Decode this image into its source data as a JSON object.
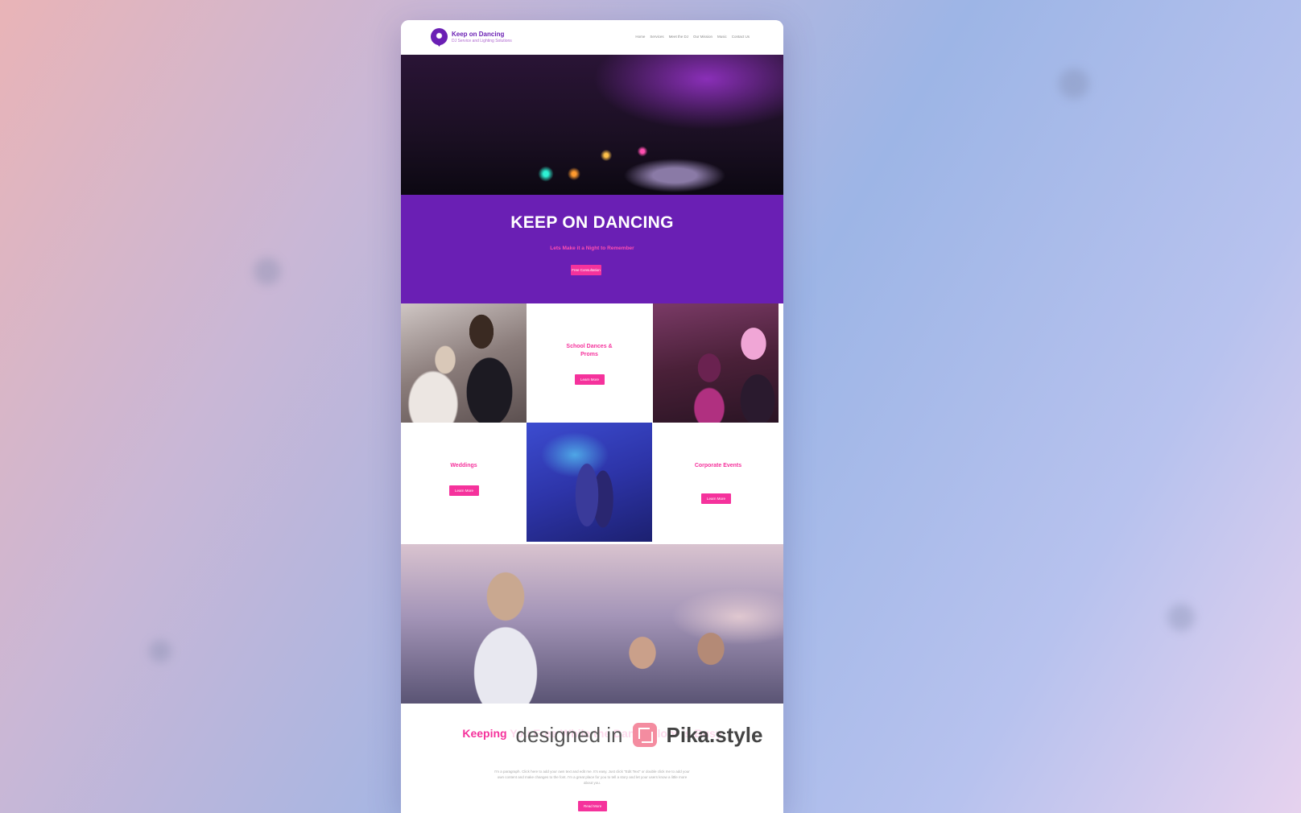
{
  "site": {
    "brand_name": "Keep on Dancing",
    "brand_tagline": "DJ Service and Lighting Solutions",
    "nav": [
      "Home",
      "Services",
      "Meet the DJ",
      "Our Mission",
      "Music",
      "Contact Us"
    ]
  },
  "hero": {
    "title": "KEEP ON DANCING",
    "subtitle": "Lets Make it a Night to Remember",
    "cta": "Free Consultation"
  },
  "services": {
    "school_dances": {
      "title": "School Dances & Proms",
      "button": "Learn More"
    },
    "weddings": {
      "title": "Weddings",
      "button": "Learn More"
    },
    "corporate": {
      "title": "Corporate Events",
      "button": "Learn More"
    }
  },
  "intro": {
    "title": "Keeping You Free While the Dance Floor is Busy",
    "body": "I'm a paragraph. Click here to add your own text and edit me. It's easy. Just click \"Edit Text\" or double click me to add your own content and make changes to the font. I'm a great place for you to tell a story and let your users know a little more about you.",
    "button": "Read More"
  },
  "watermark": {
    "prefix": "designed in",
    "brand": "Pika.style"
  },
  "colors": {
    "purple": "#6a1fb4",
    "pink": "#f5329c"
  }
}
